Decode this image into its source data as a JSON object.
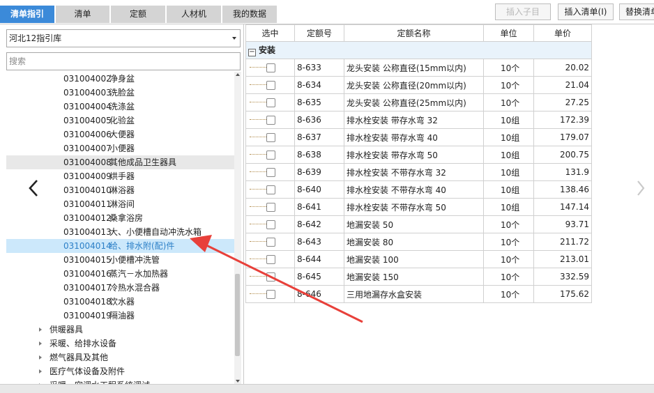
{
  "tabs": [
    {
      "label": "清单指引",
      "active": true
    },
    {
      "label": "清单"
    },
    {
      "label": "定额"
    },
    {
      "label": "人材机"
    },
    {
      "label": "我的数据"
    }
  ],
  "toolbar": {
    "insert_child": "插入子目",
    "insert_bill": "插入清单(I)",
    "replace_bill": "替换清单"
  },
  "library": {
    "selected": "河北12指引库"
  },
  "search": {
    "placeholder": "搜索"
  },
  "tree_items": [
    {
      "code": "031004002",
      "name": "净身盆"
    },
    {
      "code": "031004003",
      "name": "洗脸盆"
    },
    {
      "code": "031004004",
      "name": "洗涤盆"
    },
    {
      "code": "031004005",
      "name": "化验盆"
    },
    {
      "code": "031004006",
      "name": "大便器"
    },
    {
      "code": "031004007",
      "name": "小便器"
    },
    {
      "code": "031004008",
      "name": "其他成品卫生器具"
    },
    {
      "code": "031004009",
      "name": "烘手器"
    },
    {
      "code": "031004010",
      "name": "淋浴器"
    },
    {
      "code": "031004011",
      "name": "淋浴间"
    },
    {
      "code": "031004012",
      "name": "桑拿浴房"
    },
    {
      "code": "031004013",
      "name": "大、小便槽自动冲洗水箱"
    },
    {
      "code": "031004014",
      "name": "给、排水附(配)件"
    },
    {
      "code": "031004015",
      "name": "小便槽冲洗管"
    },
    {
      "code": "031004016",
      "name": "蒸汽－水加热器"
    },
    {
      "code": "031004017",
      "name": "冷热水混合器"
    },
    {
      "code": "031004018",
      "name": "饮水器"
    },
    {
      "code": "031004019",
      "name": "隔油器"
    }
  ],
  "tree_groups": [
    {
      "name": "供暖器具"
    },
    {
      "name": "采暖、给排水设备"
    },
    {
      "name": "燃气器具及其他"
    },
    {
      "name": "医疗气体设备及附件"
    },
    {
      "name": "采暖、空调水工程系统调试"
    }
  ],
  "grid": {
    "headers": {
      "select": "选中",
      "code": "定额号",
      "name": "定额名称",
      "unit": "单位",
      "price": "单价"
    },
    "group_label": "安装",
    "group_toggle": "−",
    "rows": [
      {
        "code": "8-633",
        "name": "龙头安装 公称直径(15mm以内)",
        "unit": "10个",
        "price": "20.02"
      },
      {
        "code": "8-634",
        "name": "龙头安装 公称直径(20mm以内)",
        "unit": "10个",
        "price": "21.04"
      },
      {
        "code": "8-635",
        "name": "龙头安装 公称直径(25mm以内)",
        "unit": "10个",
        "price": "27.25"
      },
      {
        "code": "8-636",
        "name": "排水栓安装 带存水弯 32",
        "unit": "10组",
        "price": "172.39"
      },
      {
        "code": "8-637",
        "name": "排水栓安装 带存水弯 40",
        "unit": "10组",
        "price": "179.07"
      },
      {
        "code": "8-638",
        "name": "排水栓安装 带存水弯 50",
        "unit": "10组",
        "price": "200.75"
      },
      {
        "code": "8-639",
        "name": "排水栓安装 不带存水弯 32",
        "unit": "10组",
        "price": "131.9"
      },
      {
        "code": "8-640",
        "name": "排水栓安装 不带存水弯 40",
        "unit": "10组",
        "price": "138.46"
      },
      {
        "code": "8-641",
        "name": "排水栓安装 不带存水弯 50",
        "unit": "10组",
        "price": "147.14"
      },
      {
        "code": "8-642",
        "name": "地漏安装 50",
        "unit": "10个",
        "price": "93.71"
      },
      {
        "code": "8-643",
        "name": "地漏安装 80",
        "unit": "10个",
        "price": "211.72"
      },
      {
        "code": "8-644",
        "name": "地漏安装 100",
        "unit": "10个",
        "price": "213.01"
      },
      {
        "code": "8-645",
        "name": "地漏安装 150",
        "unit": "10个",
        "price": "332.59"
      },
      {
        "code": "8-646",
        "name": "三用地漏存水盒安装",
        "unit": "10个",
        "price": "175.62"
      }
    ]
  },
  "nav": {
    "prev_icon": "chevron-left-icon",
    "next_icon": "chevron-right-icon"
  },
  "colors": {
    "accent": "#3b8ad9",
    "selection": "#cce8fb",
    "annotation_arrow": "#e8403a"
  }
}
